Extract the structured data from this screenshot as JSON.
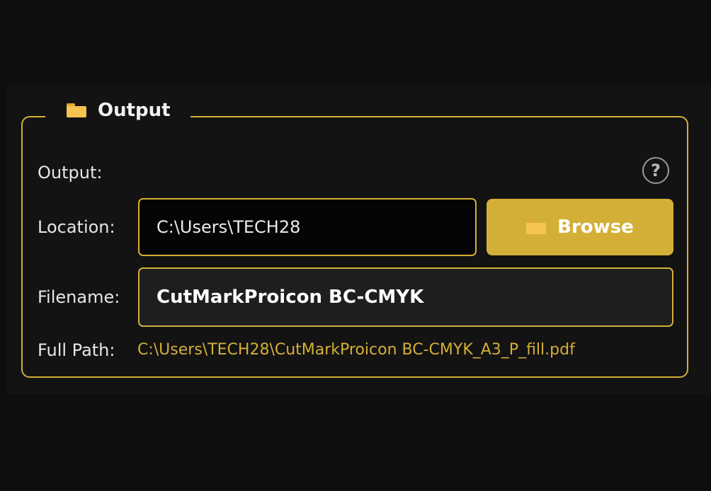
{
  "group": {
    "title": "Output",
    "title_icon": "folder-icon"
  },
  "output_row": {
    "label": "Output:",
    "help_icon": "?"
  },
  "location_row": {
    "label": "Location:",
    "value": "C:\\Users\\TECH28",
    "browse_label": "Browse",
    "browse_icon": "folder-icon"
  },
  "filename_row": {
    "label": "Filename:",
    "value": "CutMarkProicon BC-CMYK"
  },
  "full_path_row": {
    "label": "Full Path:",
    "value": "C:\\Users\\TECH28\\CutMarkProicon BC-CMYK_A3_P_fill.pdf"
  },
  "colors": {
    "accent": "#d4af37",
    "background": "#0e0e0e",
    "panel": "#131313",
    "text": "#e6e6e6"
  }
}
